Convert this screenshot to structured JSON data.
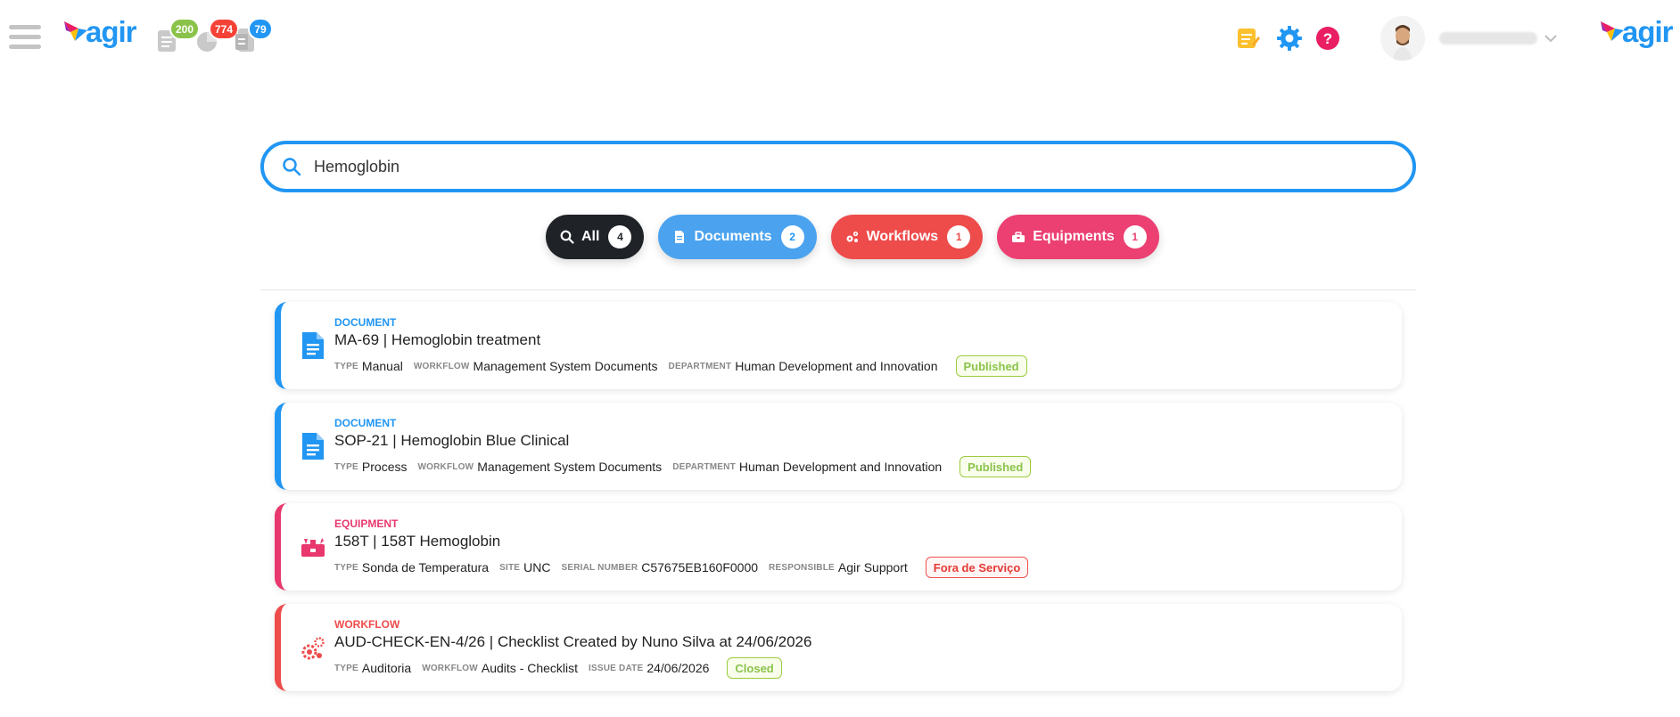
{
  "header": {
    "logo_text": "agir",
    "counters": [
      {
        "name": "documents-pending",
        "value": "200",
        "color": "#8bc34a"
      },
      {
        "name": "tasks-overdue",
        "value": "774",
        "color": "#f44336"
      },
      {
        "name": "records-pending",
        "value": "79",
        "color": "#2196f3"
      }
    ],
    "tools": [
      "notes-icon",
      "settings-icon",
      "help-icon"
    ]
  },
  "search": {
    "value": "Hemoglobin"
  },
  "filters": [
    {
      "label": "All",
      "count": "4",
      "icon": "search-icon",
      "color": "#1f2328"
    },
    {
      "label": "Documents",
      "count": "2",
      "icon": "document-icon",
      "color": "#4ba3ef"
    },
    {
      "label": "Workflows",
      "count": "1",
      "icon": "workflow-icon",
      "color": "#ee4b4b"
    },
    {
      "label": "Equipments",
      "count": "1",
      "icon": "toolbox-icon",
      "color": "#ec3f72"
    }
  ],
  "results": [
    {
      "kind": "DOCUMENT",
      "title": "MA-69 | Hemoglobin treatment",
      "fields": [
        {
          "key": "TYPE",
          "value": "Manual"
        },
        {
          "key": "WORKFLOW",
          "value": "Management System Documents"
        },
        {
          "key": "DEPARTMENT",
          "value": "Human Development and Innovation"
        }
      ],
      "status": "Published"
    },
    {
      "kind": "DOCUMENT",
      "title": "SOP-21 | Hemoglobin Blue Clinical",
      "fields": [
        {
          "key": "TYPE",
          "value": "Process"
        },
        {
          "key": "WORKFLOW",
          "value": "Management System Documents"
        },
        {
          "key": "DEPARTMENT",
          "value": "Human Development and Innovation"
        }
      ],
      "status": "Published"
    },
    {
      "kind": "EQUIPMENT",
      "title": "158T | 158T Hemoglobin",
      "fields": [
        {
          "key": "TYPE",
          "value": "Sonda de Temperatura"
        },
        {
          "key": "SITE",
          "value": "UNC"
        },
        {
          "key": "SERIAL NUMBER",
          "value": "C57675EB160F0000"
        },
        {
          "key": "RESPONSIBLE",
          "value": "Agir Support"
        }
      ],
      "status": "Fora de Serviço"
    },
    {
      "kind": "WORKFLOW",
      "title": "AUD-CHECK-EN-4/26 | Checklist Created by Nuno Silva at 24/06/2026",
      "fields": [
        {
          "key": "TYPE",
          "value": "Auditoria"
        },
        {
          "key": "WORKFLOW",
          "value": "Audits - Checklist"
        },
        {
          "key": "ISSUE DATE",
          "value": "24/06/2026"
        }
      ],
      "status": "Closed"
    }
  ]
}
